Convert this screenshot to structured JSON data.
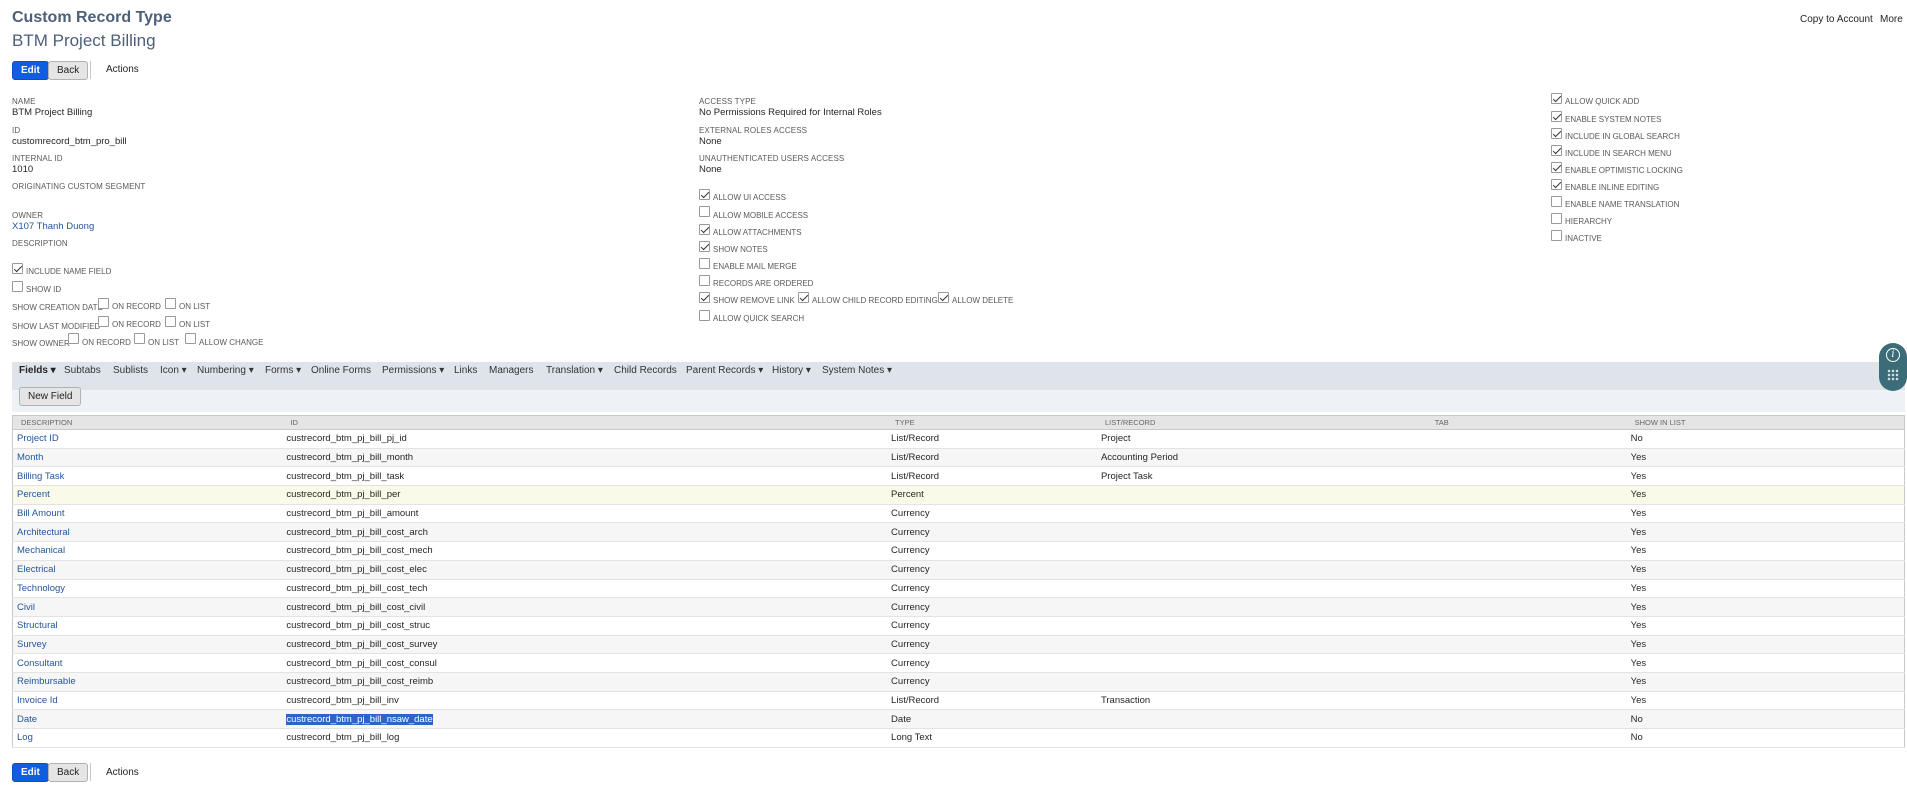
{
  "header": {
    "record_type": "Custom Record Type",
    "title": "BTM Project Billing",
    "copy_to_account": "Copy to Account",
    "more": "More"
  },
  "toolbar": {
    "edit": "Edit",
    "back": "Back",
    "actions": "Actions"
  },
  "primary": {
    "name_label": "Name",
    "name_value": "BTM Project Billing",
    "id_label": "ID",
    "id_value": "customrecord_btm_pro_bill",
    "internal_id_label": "Internal ID",
    "internal_id_value": "1010",
    "originating_label": "Originating Custom Segment",
    "owner_label": "Owner",
    "owner_value": "X107 Thanh Duong",
    "description_label": "Description",
    "include_name_field": "Include Name Field",
    "show_id": "Show ID",
    "show_creation_date": "Show Creation Date",
    "show_last_modified": "Show Last Modified",
    "show_owner": "Show Owner",
    "on_record": "On Record",
    "on_list": "On List",
    "allow_change": "Allow Change"
  },
  "access": {
    "access_type_label": "Access Type",
    "access_type_value": "No Permissions Required for Internal Roles",
    "external_label": "External Roles Access",
    "external_value": "None",
    "unauth_label": "Unauthenticated Users Access",
    "unauth_value": "None",
    "allow_ui_access": "Allow UI Access",
    "allow_mobile_access": "Allow Mobile Access",
    "allow_attachments": "Allow Attachments",
    "show_notes": "Show Notes",
    "enable_mail_merge": "Enable Mail Merge",
    "records_are_ordered": "Records Are Ordered",
    "show_remove_link": "Show Remove Link",
    "allow_child_record_editing": "Allow Child Record Editing",
    "allow_delete": "Allow Delete",
    "allow_quick_search": "Allow Quick Search"
  },
  "options": {
    "allow_quick_add": "Allow Quick Add",
    "enable_system_notes": "Enable System Notes",
    "include_in_global_search": "Include in Global Search",
    "include_in_search_menu": "Include in Search Menu",
    "enable_optimistic_locking": "Enable Optimistic Locking",
    "enable_inline_editing": "Enable Inline Editing",
    "enable_name_translation": "Enable Name Translation",
    "hierarchy": "Hierarchy",
    "inactive": "Inactive"
  },
  "tabs": {
    "fields": "Fields",
    "subtabs": "Subtabs",
    "sublists": "Sublists",
    "icon": "Icon",
    "numbering": "Numbering",
    "forms": "Forms",
    "online_forms": "Online Forms",
    "permissions": "Permissions",
    "links": "Links",
    "managers": "Managers",
    "translation": "Translation",
    "child_records": "Child Records",
    "parent_records": "Parent Records",
    "history": "History",
    "system_notes": "System Notes"
  },
  "new_field_button": "New Field",
  "columns": {
    "description": "Description",
    "id": "ID",
    "type": "Type",
    "list_record": "List/Record",
    "tab": "Tab",
    "show_in_list": "Show in List"
  },
  "rows": [
    {
      "description": "Project ID",
      "id": "custrecord_btm_pj_bill_pj_id",
      "type": "List/Record",
      "list_record": "Project",
      "tab": "",
      "show_in_list": "No"
    },
    {
      "description": "Month",
      "id": "custrecord_btm_pj_bill_month",
      "type": "List/Record",
      "list_record": "Accounting Period",
      "tab": "",
      "show_in_list": "Yes"
    },
    {
      "description": "Billing Task",
      "id": "custrecord_btm_pj_bill_task",
      "type": "List/Record",
      "list_record": "Project Task",
      "tab": "",
      "show_in_list": "Yes"
    },
    {
      "description": "Percent",
      "id": "custrecord_btm_pj_bill_per",
      "type": "Percent",
      "list_record": "",
      "tab": "",
      "show_in_list": "Yes"
    },
    {
      "description": "Bill Amount",
      "id": "custrecord_btm_pj_bill_amount",
      "type": "Currency",
      "list_record": "",
      "tab": "",
      "show_in_list": "Yes"
    },
    {
      "description": "Architectural",
      "id": "custrecord_btm_pj_bill_cost_arch",
      "type": "Currency",
      "list_record": "",
      "tab": "",
      "show_in_list": "Yes"
    },
    {
      "description": "Mechanical",
      "id": "custrecord_btm_pj_bill_cost_mech",
      "type": "Currency",
      "list_record": "",
      "tab": "",
      "show_in_list": "Yes"
    },
    {
      "description": "Electrical",
      "id": "custrecord_btm_pj_bill_cost_elec",
      "type": "Currency",
      "list_record": "",
      "tab": "",
      "show_in_list": "Yes"
    },
    {
      "description": "Technology",
      "id": "custrecord_btm_pj_bill_cost_tech",
      "type": "Currency",
      "list_record": "",
      "tab": "",
      "show_in_list": "Yes"
    },
    {
      "description": "Civil",
      "id": "custrecord_btm_pj_bill_cost_civil",
      "type": "Currency",
      "list_record": "",
      "tab": "",
      "show_in_list": "Yes"
    },
    {
      "description": "Structural",
      "id": "custrecord_btm_pj_bill_cost_struc",
      "type": "Currency",
      "list_record": "",
      "tab": "",
      "show_in_list": "Yes"
    },
    {
      "description": "Survey",
      "id": "custrecord_btm_pj_bill_cost_survey",
      "type": "Currency",
      "list_record": "",
      "tab": "",
      "show_in_list": "Yes"
    },
    {
      "description": "Consultant",
      "id": "custrecord_btm_pj_bill_cost_consul",
      "type": "Currency",
      "list_record": "",
      "tab": "",
      "show_in_list": "Yes"
    },
    {
      "description": "Reimbursable",
      "id": "custrecord_btm_pj_bill_cost_reimb",
      "type": "Currency",
      "list_record": "",
      "tab": "",
      "show_in_list": "Yes"
    },
    {
      "description": "Invoice Id",
      "id": "custrecord_btm_pj_bill_inv",
      "type": "List/Record",
      "list_record": "Transaction",
      "tab": "",
      "show_in_list": "Yes"
    },
    {
      "description": "Date",
      "id": "custrecord_btm_pj_bill_nsaw_date",
      "type": "Date",
      "list_record": "",
      "tab": "",
      "show_in_list": "No"
    },
    {
      "description": "Log",
      "id": "custrecord_btm_pj_bill_log",
      "type": "Long Text",
      "list_record": "",
      "tab": "",
      "show_in_list": "No"
    }
  ],
  "colors": {
    "primary_button": "#125ddf",
    "link": "#255599",
    "tabbar": "#dfe4eb",
    "title": "#4d5f79"
  }
}
